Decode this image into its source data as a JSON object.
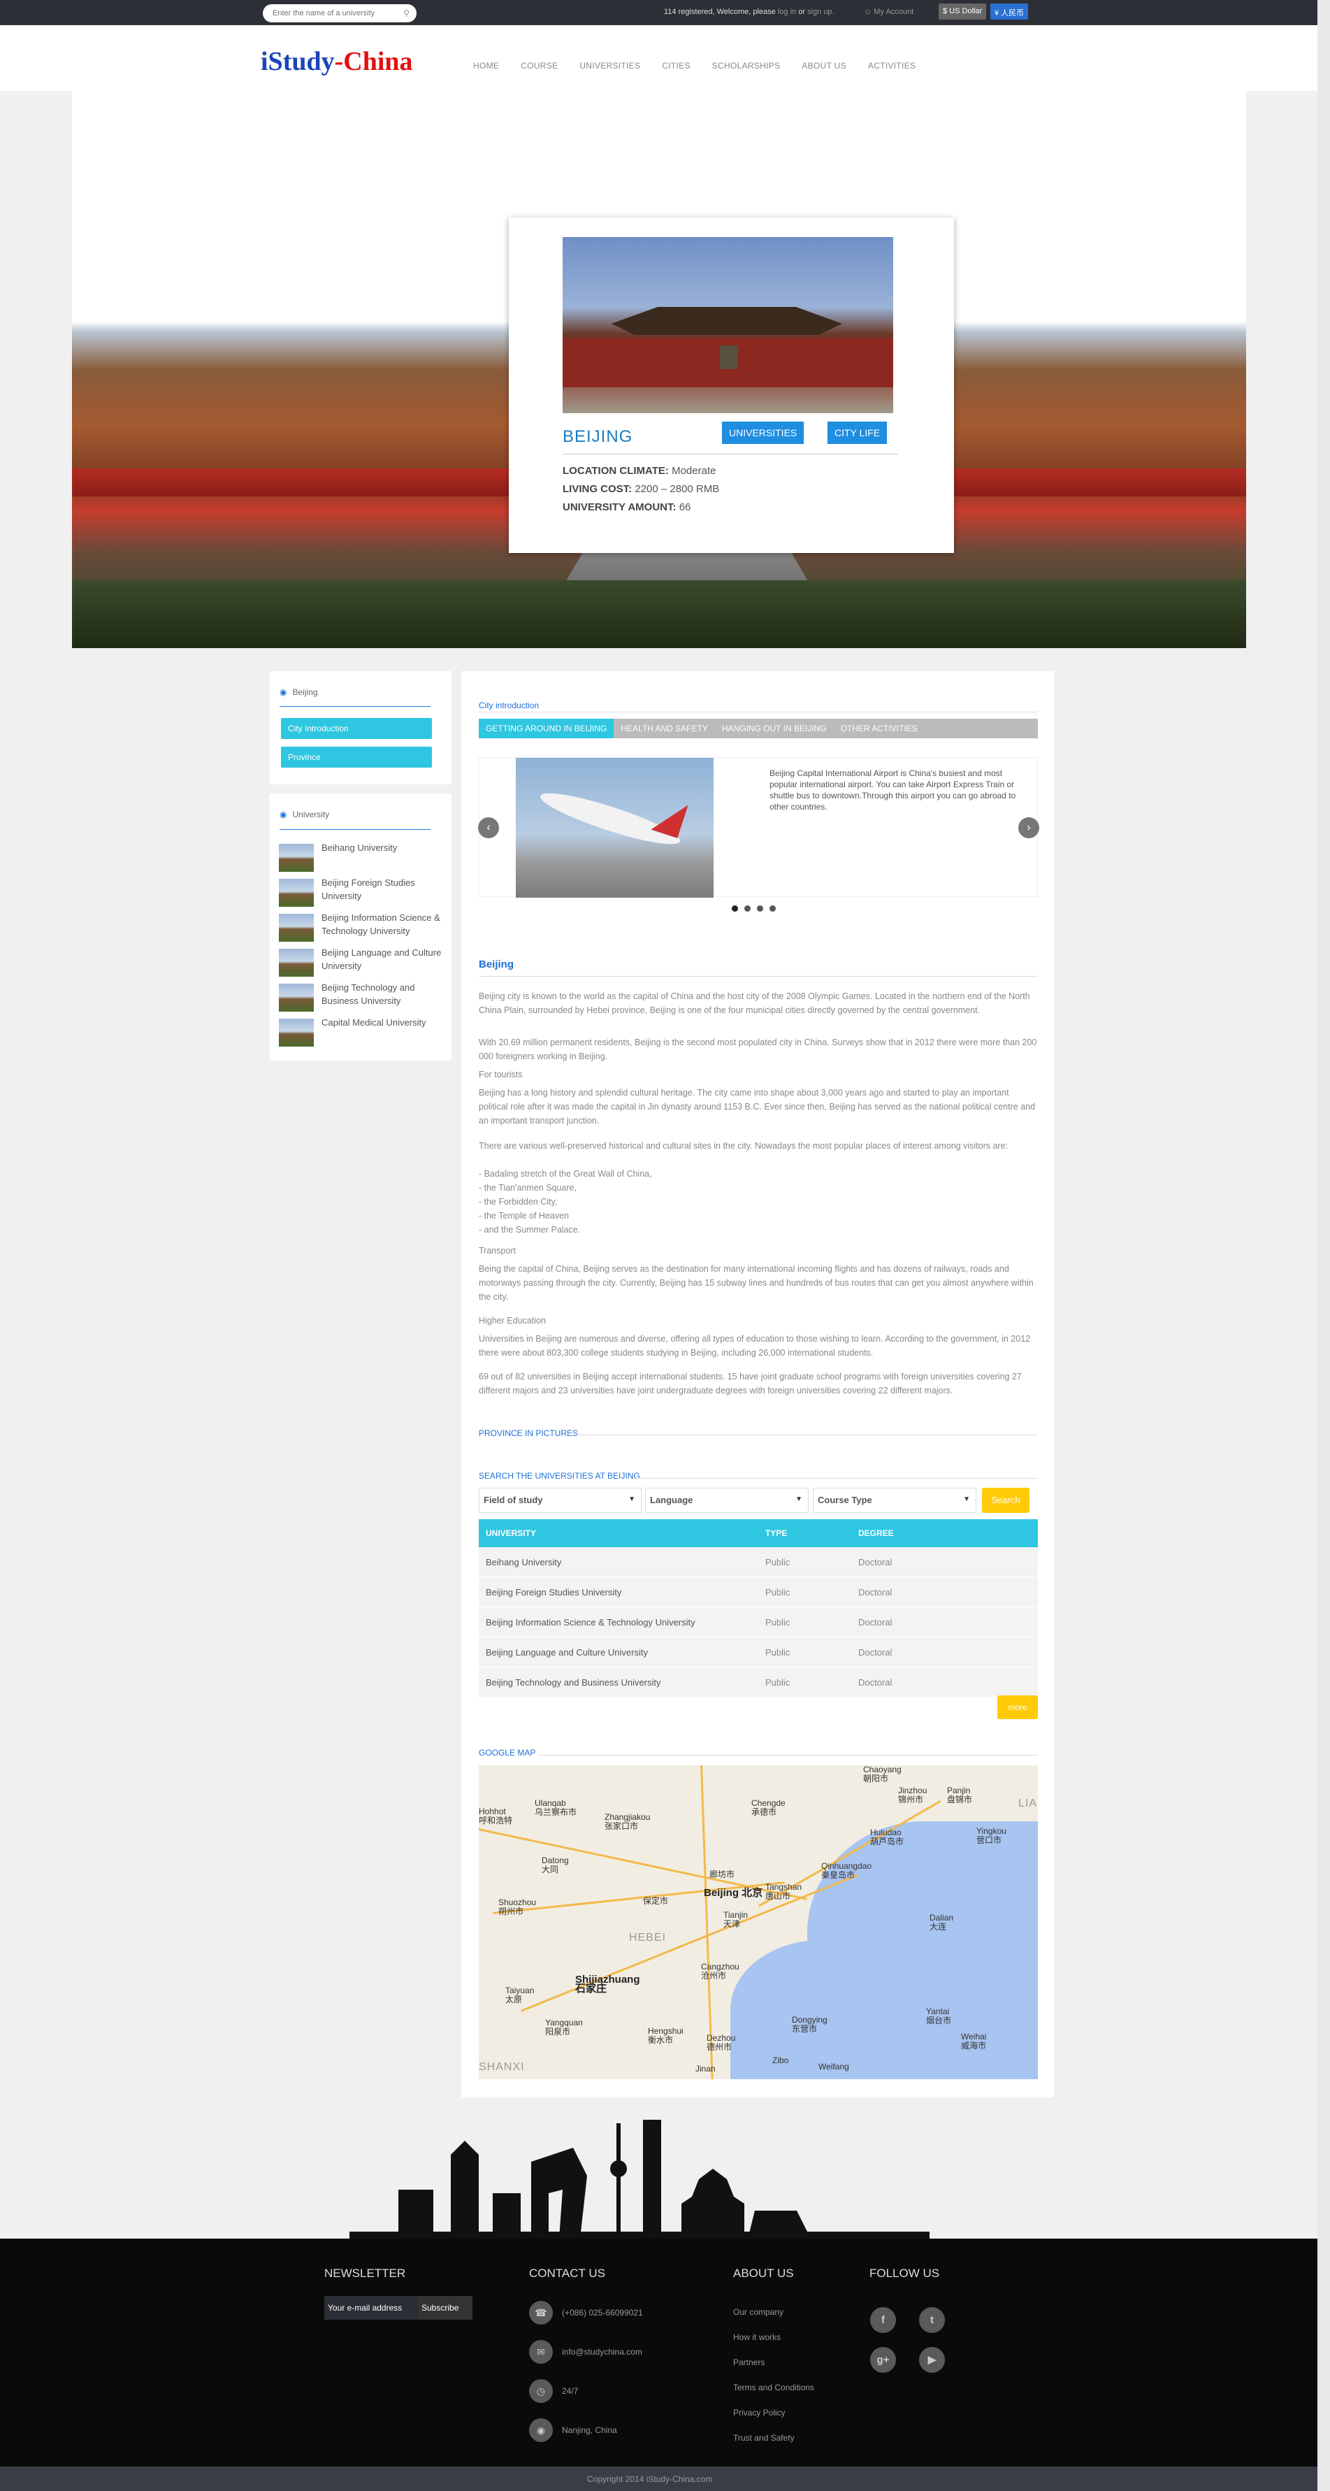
{
  "topbar": {
    "search_placeholder": "Enter the name of a university",
    "welcome_prefix": "114 registered, Welcome, please",
    "login": "log in",
    "or": "or",
    "signup": "sign up.",
    "my_account": "My Account",
    "currency_usd": "$ US Dollar",
    "currency_rmb": "¥ 人民币"
  },
  "header": {
    "logo_part1": "iStudy",
    "logo_part2": "-China",
    "nav": [
      "HOME",
      "COURSE",
      "UNIVERSITIES",
      "CITIES",
      "SCHOLARSHIPS",
      "ABOUT US",
      "ACTIVITIES"
    ]
  },
  "city_card": {
    "name": "BEIJING",
    "btn_universities": "UNIVERSITIES",
    "btn_city_life": "CITY LIFE",
    "climate_label": "LOCATION CLIMATE:",
    "climate_value": "Moderate",
    "cost_label": "LIVING COST:",
    "cost_value": "2200 – 2800 RMB",
    "amount_label": "UNIVERSITY AMOUNT:",
    "amount_value": "66"
  },
  "sidebar": {
    "city_title": "Beijing",
    "city_links": [
      "City Introduction",
      "Province"
    ],
    "uni_title": "University",
    "universities": [
      "Beihang University",
      "Beijing Foreign Studies University",
      "Beijing Information Science & Technology University",
      "Beijing Language and Culture University",
      "Beijing Technology and Business University",
      "Capital Medical University"
    ]
  },
  "main": {
    "intro_label": "City introduction",
    "tabs": [
      "GETTING AROUND IN BEIJING",
      "HEALTH AND SAFETY",
      "HANGING OUT IN BEIJING",
      "OTHER ACTIVITIES"
    ],
    "slide_text": "Beijing Capital International Airport is China's busiest and most popular international airport. You can take Airport Express Train or shuttle bus to downtown.Through this airport you can go abroad to other countries.",
    "body_title": "Beijing",
    "paragraphs": [
      "Beijing city is known to the world as the capital of China and the host city of the 2008 Olympic Games. Located in the northern end of the North China Plain, surrounded by Hebei province, Beijing is one of the four municipal cities directly governed by the central government.",
      "With 20.69 million permanent residents, Beijing is the second most populated city in China. Surveys show that in 2012 there were more than 200 000 foreigners working in Beijing.",
      "For tourists",
      "Beijing has a long history and splendid cultural heritage. The city came into shape about 3,000 years ago and started to play an important political role after it was made the capital in Jin dynasty around 1153 B.C. Ever since then, Beijing has served as the national political centre and an important transport junction.",
      "There are various well-preserved historical and cultural sites in the city. Nowadays the most popular places of interest among visitors are:",
      "- Badaling stretch of the Great Wall of China,",
      "- the Tian'anmen Square,",
      "- the Forbidden City,",
      "- the Temple of Heaven",
      "- and the Summer Palace.",
      "Transport",
      "Being the capital of China, Beijing serves as the destination for many international incoming flights and has dozens of railways, roads and motorways passing through the city. Currently, Beijing has 15 subway lines and hundreds of bus routes that can get you almost anywhere within the city.",
      "Higher Education",
      "Universities in Beijing are numerous and diverse, offering all types of education to those wishing to learn. According to the government, in 2012 there were about 803,300 college students studying in Beijing, including 26,000 international students.",
      "69 out of 82 universities in Beijing accept international students. 15 have joint graduate school programs with foreign universities covering 27 different majors and 23 universities have joint undergraduate degrees with foreign universities covering 22 different majors."
    ],
    "province_pictures": "PROVINCE IN PICTURES",
    "search_label": "SEARCH THE UNIVERSITIES AT BEIJING",
    "select_field": "Field of study",
    "select_language": "Language",
    "select_course": "Course Type",
    "search_btn": "Search",
    "table_headers": [
      "UNIVERSITY",
      "TYPE",
      "DEGREE"
    ],
    "table_rows": [
      [
        "Beihang University",
        "Public",
        "Doctoral"
      ],
      [
        "Beijing Foreign Studies University",
        "Public",
        "Doctoral"
      ],
      [
        "Beijing Information Science & Technology University",
        "Public",
        "Doctoral"
      ],
      [
        "Beijing Language and Culture University",
        "Public",
        "Doctoral"
      ],
      [
        "Beijing Technology and Business University",
        "Public",
        "Doctoral"
      ]
    ],
    "more_btn": "more",
    "google_map": "GOOGLE MAP",
    "map_labels": {
      "hohhot": "Hohhot\n呼和浩特",
      "ulanqab": "Ulanqab\n乌兰察布市",
      "zhangjiakou": "Zhangjiakou\n张家口市",
      "chengde": "Chengde\n承德市",
      "chaoyang": "Chaoyang\n朝阳市",
      "jinzhou": "Jinzhou\n锦州市",
      "panjin": "Panjin\n盘锦市",
      "datong": "Datong\n大同",
      "beijing": "Beijing 北京",
      "tangshan": "Tangshan\n唐山市",
      "qinhuangdao": "Qinhuangdao\n秦皇岛市",
      "huludao": "Huludao\n葫芦岛市",
      "yingkou": "Yingkou\n营口市",
      "shuozhou": "Shuozhou\n朔州市",
      "tianjin": "Tianjin\n天津",
      "langfang": "廊坊市",
      "baoding": "保定市",
      "dalian": "Dalian\n大连",
      "hebei": "HEBEI",
      "cangzhou": "Cangzhou\n沧州市",
      "shijiazhuang": "Shijiazhuang\n石家庄",
      "taiyuan": "Taiyuan\n太原",
      "yangquan": "Yangquan\n阳泉市",
      "hengshui": "Hengshui\n衡水市",
      "dezhou": "Dezhou\n德州市",
      "dongying": "Dongying\n东营市",
      "yantai": "Yantai\n烟台市",
      "weihai": "Weihai\n威海市",
      "shanxi": "SHANXI",
      "jinan": "Jinan",
      "zibo": "Zibo",
      "weifang": "Weifang",
      "lia": "LIA"
    }
  },
  "footer": {
    "newsletter_title": "NEWSLETTER",
    "email_placeholder": "Your e-mail address",
    "subscribe": "Subscribe",
    "contact_title": "CONTACT US",
    "phone": "(+086) 025-66099021",
    "email": "info@studychina.com",
    "hours": "24/7",
    "location": "Nanjing, China",
    "about_title": "ABOUT US",
    "about_links": [
      "Our company",
      "How it works",
      "Partners",
      "Terms and Conditions",
      "Privacy Policy",
      "Trust and Safety"
    ],
    "follow_title": "FOLLOW US",
    "copyright": "Copyright 2014 iStudy-China.com"
  }
}
